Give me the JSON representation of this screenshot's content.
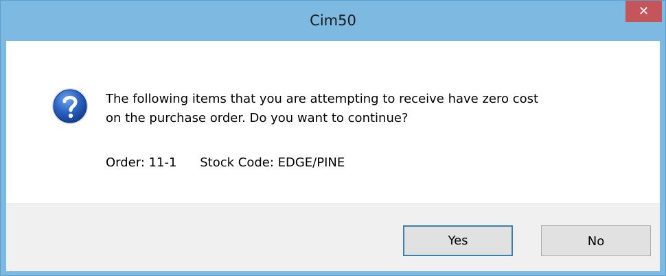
{
  "window": {
    "title": "Cim50",
    "close_glyph": "✕"
  },
  "dialog": {
    "icon": "question-icon",
    "message_lines": [
      "The following items that you are attempting to receive have zero cost",
      "on the purchase order. Do you want to continue?"
    ],
    "order_text": "Order: 11-1",
    "stock_text": "Stock Code: EDGE/PINE"
  },
  "buttons": {
    "yes_label": "Yes",
    "no_label": "No"
  },
  "colors": {
    "titlebar": "#7db9e0",
    "close": "#c4555b",
    "footer": "#f0f0f0",
    "focus_border": "#3c7fb1"
  }
}
